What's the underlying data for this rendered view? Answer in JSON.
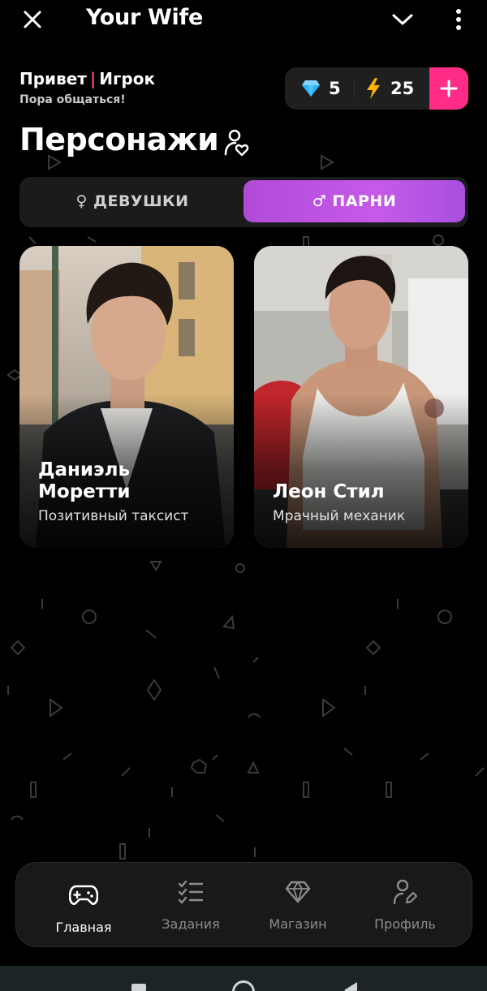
{
  "app": {
    "title": "Your Wife"
  },
  "greeting": {
    "hello": "Привет",
    "separator": "|",
    "username": "Игрок",
    "subtitle": "Пора общаться!"
  },
  "wallet": {
    "gems": "5",
    "energy": "25",
    "gem_icon": "diamond-icon",
    "energy_icon": "lightning-icon",
    "add_icon": "plus-icon",
    "accent": "#ff2d87"
  },
  "section": {
    "title": "Персонажи",
    "icon": "user-heart-icon"
  },
  "filter": {
    "options": [
      {
        "label": "♀ ДЕВУШКИ",
        "active": false
      },
      {
        "label": "♂ ПАРНИ",
        "active": true
      }
    ],
    "active_gradient": [
      "#b04bd8",
      "#c65ae8"
    ]
  },
  "characters": [
    {
      "name": "Даниэль Моретти",
      "role": "Позитивный таксист"
    },
    {
      "name": "Леон Стил",
      "role": "Мрачный механик"
    }
  ],
  "bottom_nav": {
    "items": [
      {
        "label": "Главная",
        "icon": "gamepad-icon",
        "active": true
      },
      {
        "label": "Задания",
        "icon": "checklist-icon",
        "active": false
      },
      {
        "label": "Магазин",
        "icon": "gem-icon",
        "active": false
      },
      {
        "label": "Профиль",
        "icon": "user-edit-icon",
        "active": false
      }
    ]
  }
}
